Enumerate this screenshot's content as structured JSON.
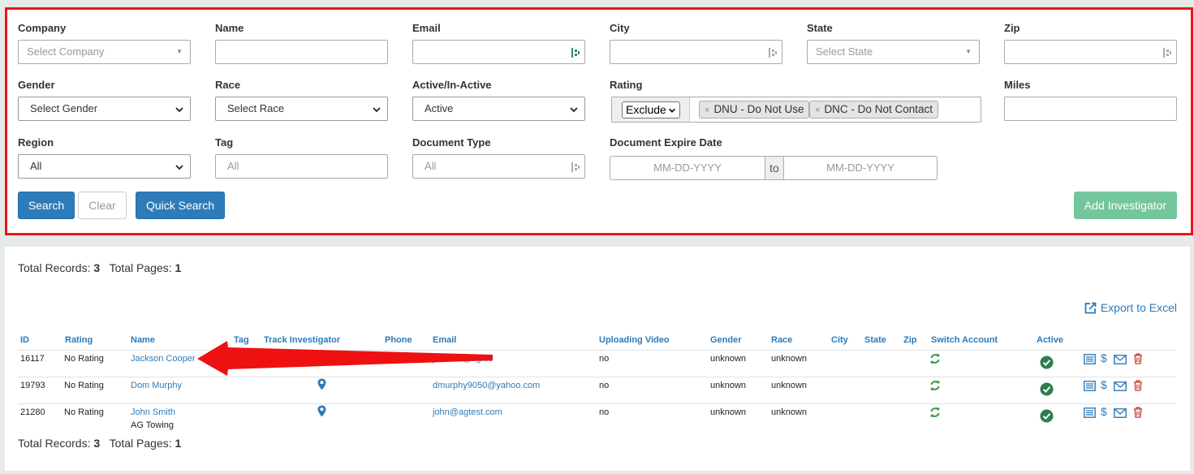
{
  "filters": {
    "company": {
      "label": "Company",
      "placeholder": "Select Company"
    },
    "name": {
      "label": "Name",
      "value": ""
    },
    "email": {
      "label": "Email",
      "value": ""
    },
    "city": {
      "label": "City",
      "value": ""
    },
    "state": {
      "label": "State",
      "placeholder": "Select State"
    },
    "zip": {
      "label": "Zip",
      "value": ""
    },
    "gender": {
      "label": "Gender",
      "selected": "Select Gender"
    },
    "race": {
      "label": "Race",
      "selected": "Select Race"
    },
    "active": {
      "label": "Active/In-Active",
      "selected": "Active"
    },
    "rating": {
      "label": "Rating",
      "mode": "Exclude",
      "tags": [
        "DNU - Do Not Use",
        "DNC - Do Not Contact"
      ],
      "remove_glyph": "×"
    },
    "miles": {
      "label": "Miles",
      "value": ""
    },
    "region": {
      "label": "Region",
      "selected": "All"
    },
    "tag": {
      "label": "Tag",
      "placeholder": "All"
    },
    "document_type": {
      "label": "Document Type",
      "placeholder": "All"
    },
    "document_expire": {
      "label": "Document Expire Date",
      "from_placeholder": "MM-DD-YYYY",
      "separator": "to",
      "to_placeholder": "MM-DD-YYYY"
    }
  },
  "buttons": {
    "search": "Search",
    "clear": "Clear",
    "quick_search": "Quick Search",
    "add_investigator": "Add Investigator"
  },
  "summary": {
    "records_label": "Total Records:",
    "records_value": "3",
    "pages_label": "Total Pages:",
    "pages_value": "1"
  },
  "export_label": "Export to Excel",
  "table": {
    "columns": [
      "ID",
      "Rating",
      "Name",
      "Tag",
      "Track Investigator",
      "Phone",
      "Email",
      "Uploading Video",
      "Gender",
      "Race",
      "City",
      "State",
      "Zip",
      "Switch Account",
      "Active"
    ],
    "rows": [
      {
        "id": "16117",
        "rating": "No Rating",
        "name": "Jackson Cooper",
        "company": "",
        "email": "jackson@lig.us",
        "uploading_video": "no",
        "gender": "unknown",
        "race": "unknown"
      },
      {
        "id": "19793",
        "rating": "No Rating",
        "name": "Dom Murphy",
        "company": "",
        "email": "dmurphy9050@yahoo.com",
        "uploading_video": "no",
        "gender": "unknown",
        "race": "unknown"
      },
      {
        "id": "21280",
        "rating": "No Rating",
        "name": "John Smith",
        "company": "AG Towing",
        "email": "john@agtest.com",
        "uploading_video": "no",
        "gender": "unknown",
        "race": "unknown"
      }
    ]
  },
  "colors": {
    "primary": "#2d7bb9",
    "success": "#6cc297",
    "highlight_border": "#e8161d",
    "active_check": "#2e7d4f",
    "switch_icon": "#3a9a4a",
    "delete_icon": "#c0392b",
    "annotation_arrow": "#ee1111"
  },
  "icons": {
    "lastpass": "lastpass-icon",
    "track": "map-pin-icon",
    "switch": "refresh-icon",
    "active": "check-circle-icon",
    "actions": [
      "details-icon",
      "dollar-icon",
      "mail-icon",
      "trash-icon"
    ],
    "export": "export-icon"
  }
}
